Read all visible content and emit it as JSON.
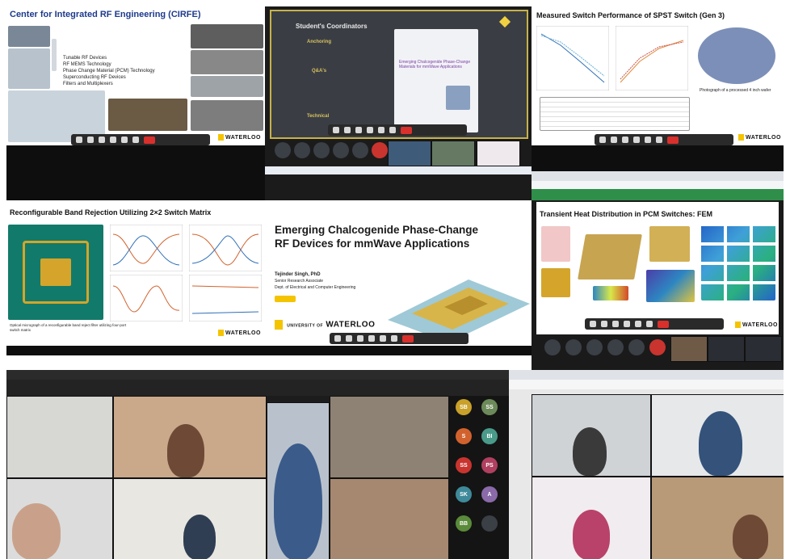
{
  "slides": {
    "cirfe": {
      "title": "Center for Integrated RF Engineering (CIRFE)",
      "bullets": [
        "Tunable RF Devices",
        "RF MEMS Technology",
        "Phase Change Material (PCM) Technology",
        "Superconducting RF Devices",
        "Filters and Multiplexers"
      ],
      "logo": "WATERLOO"
    },
    "coordinators": {
      "title": "Student's Coordinators",
      "groups": [
        "Anchoring",
        "Q&A's",
        "Technical"
      ],
      "poster_title": "Emerging Chalcogenide Phase-Change Materials for mmWave Applications"
    },
    "spst": {
      "title": "Measured Switch Performance of SPST Switch (Gen 3)",
      "caption": "Photograph of a processed 4 inch wafer",
      "logo": "WATERLOO"
    },
    "band_rejection": {
      "title": "Reconfigurable Band Rejection Utilizing 2×2 Switch Matrix",
      "caption": "Optical micrograph of a reconfigurable band reject filter utilizing four-port switch matrix",
      "logo": "WATERLOO"
    },
    "main": {
      "title_line1": "Emerging Chalcogenide Phase-Change",
      "title_line2": "RF Devices for mmWave Applications",
      "author": "Tejinder Singh, PhD",
      "role": "Senior Research Associate",
      "dept": "Dept. of Electrical and Computer Engineering",
      "logo_top": "UNIVERSITY OF",
      "logo": "WATERLOO"
    },
    "fem": {
      "title": "Transient Heat Distribution in PCM Switches: FEM",
      "logo": "WATERLOO"
    }
  },
  "participants": {
    "avatars": [
      "SB",
      "SS",
      "S",
      "BI",
      "SS",
      "PS",
      "SK",
      "A",
      "BB"
    ],
    "colors": {
      "accent_red": "#d9302c",
      "toolbar": "#2a2a2a",
      "pcb_teal": "#127a6a",
      "gold": "#d4a52a"
    }
  }
}
